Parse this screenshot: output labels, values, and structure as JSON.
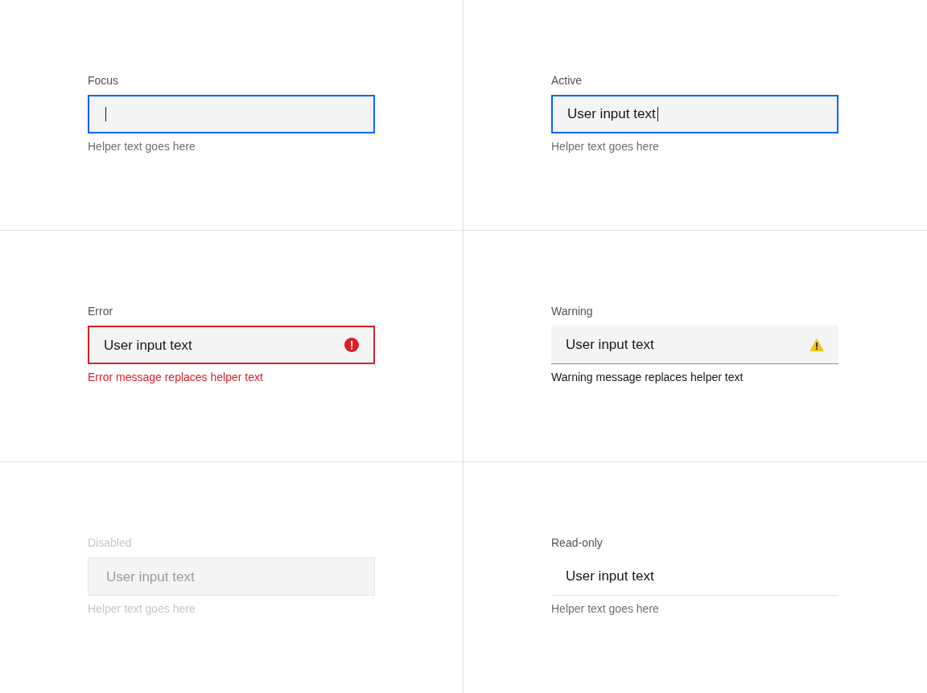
{
  "fields": [
    {
      "kind": "focus",
      "label": "Focus",
      "helper": "Helper text goes here"
    },
    {
      "kind": "active",
      "label": "Active",
      "value": "User input text",
      "helper": "Helper text goes here"
    },
    {
      "kind": "error",
      "label": "Error",
      "value": "User input text",
      "helper": "Error message replaces helper text"
    },
    {
      "kind": "warning",
      "label": "Warning",
      "value": "User input text",
      "helper": "Warning message replaces helper text"
    },
    {
      "kind": "disabled",
      "label": "Disabled",
      "value": "User input text",
      "helper": "Helper text goes here"
    },
    {
      "kind": "readonly",
      "label": "Read-only",
      "value": "User input text",
      "helper": "Helper text goes here"
    }
  ]
}
